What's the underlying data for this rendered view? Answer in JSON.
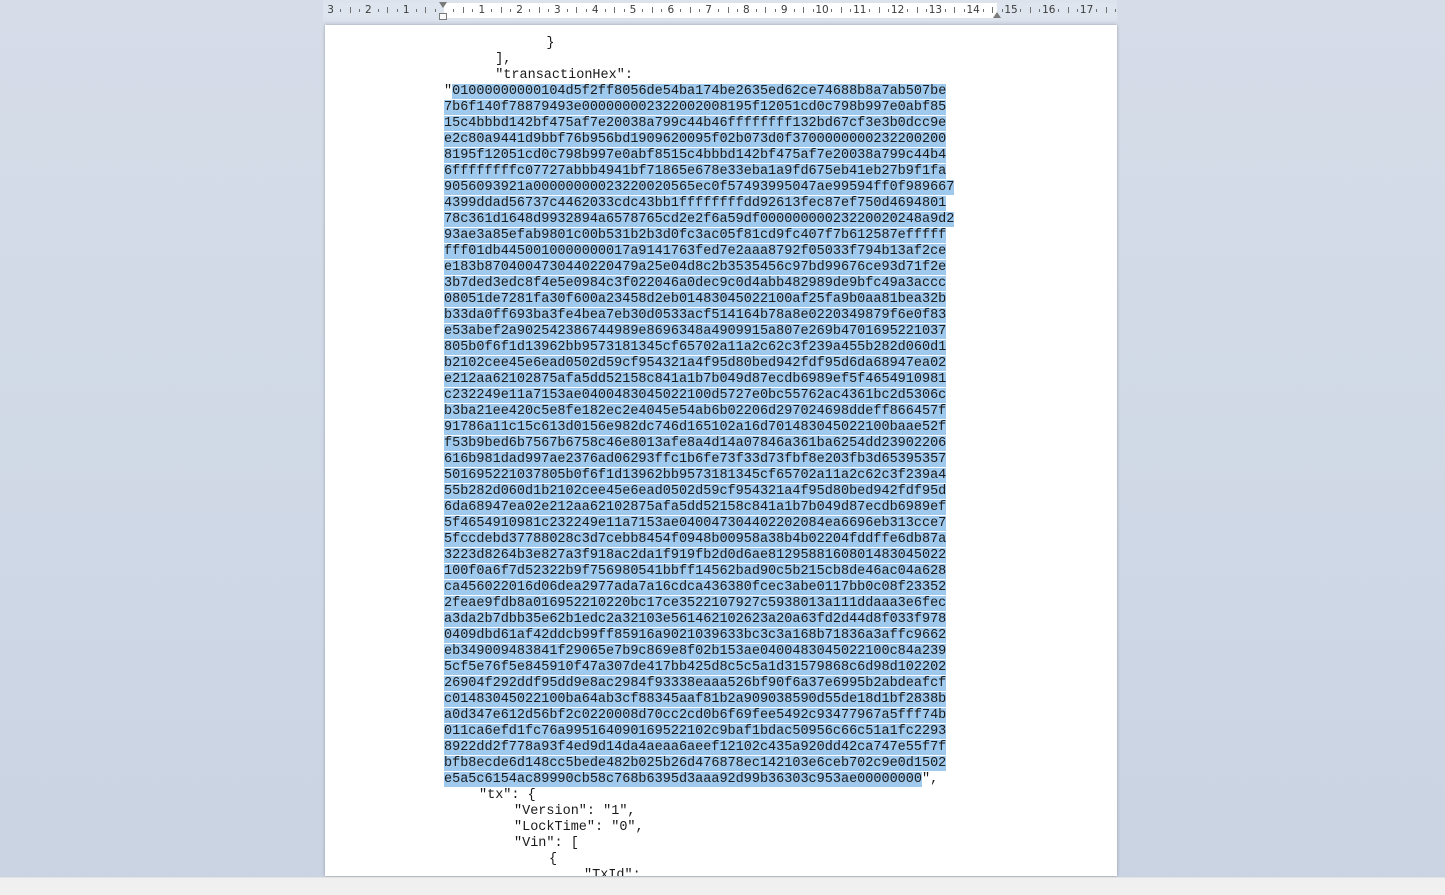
{
  "ruler": {
    "numbers": [
      "3",
      "2",
      "1",
      "1",
      "2",
      "3",
      "4",
      "5",
      "6",
      "7",
      "8",
      "9",
      "10",
      "11",
      "12",
      "13",
      "14",
      "15",
      "16",
      "17"
    ]
  },
  "document": {
    "lines_before": [
      "    }",
      "  ],",
      "  \"transactionHex\":"
    ],
    "hex_open_quote": "\"",
    "hex_lines": [
      "01000000000104d5f2ff8056de54ba174be2635ed62ce74688b8a7ab507be",
      "7b6f140f78879493e000000002322002008195f12051cd0c798b997e0abf85",
      "15c4bbbd142bf475af7e20038a799c44b46ffffffff132bd67cf3e3b0dcc9e",
      "e2c80a9441d9bbf76b956bd1909620095f02b073d0f3700000000232200200",
      "8195f12051cd0c798b997e0abf8515c4bbbd142bf475af7e20038a799c44b4",
      "6ffffffffc07727abbb4941bf71865e678e33eba1a9fd675eb41eb27b9f1fa",
      "9056093921a000000000232200205 65ec0f57493995047ae99594ff0f989667",
      "4399ddad56737c4462033cdc43bb1ffffffffdd92613fec87ef750d4694801",
      "78c361d1648d9932894a6578765cd2e2f6a59df000000000232200 20248a9d2",
      "93ae3a85efab9801c00b531b2b3d0fc3ac05f81cd9fc407f7b612587efffff",
      "fff01db4450010000000017a9141763fed7e2aaa8792f05033f794b13af2ce",
      "e183b8704004730440220479a25e04d8c2b3535456c97bd99676ce93d71f2e",
      "3b7ded3edc8f4e5e0984c3f022046a0dec9c0d4abb482989de9bfc49a3accc",
      "08051de7281fa30f600a23458d2eb01483045022100af25fa9b0aa81bea32b",
      "b33da0ff693ba3fe4bea7eb30d0533acf514164b78a8e0220349879f6e0f83",
      "e53abef2a902542386744989e8696348a4909915a807e269b4701695221037",
      "805b0f6f1d13962bb9573181345cf65702a11a2c62c3f239a455b282d060d1",
      "b2102cee45e6ead0502d59cf954321a4f95d80bed942fdf95d6da68947ea02",
      "e212aa62102875afa5dd52158c841a1b7b049d87ecdb6989ef5f4654910981",
      "c232249e11a7153ae0400483045022100d5727e0bc55762ac4361bc2d5306c",
      "b3ba21ee420c5e8fe182ec2e4045e54ab6b02206d297024698ddeff866457f",
      "91786a11c15c613d0156e982dc746d165102a16d701483045022100baae52f",
      "f53b9bed6b7567b6758c46e8013afe8a4d14a07846a361ba6254dd23902206",
      "616b981dad997ae2376ad06293ffc1b6fe73f33d73fbf8e203fb3d65395357",
      "501695221037805b0f6f1d13962bb9573181345cf65702a11a2c62c3f239a4",
      "55b282d060d1b2102cee45e6ead0502d59cf954321a4f95d80bed942fdf95d",
      "6da68947ea02e212aa62102875afa5dd52158c841a1b7b049d87ecdb6989ef",
      "5f4654910981c232249e11a7153ae040047304402202084ea6696eb313cce7",
      "5fccdebd37788028c3d7cebb8454f0948b00958a38b4b02204fddffe6db87a",
      "3223d8264b3e827a3f918ac2da1f919fb2d0d6ae8129588160801483045022",
      "100f0a6f7d52322b9f756980541bbff14562bad90c5b215cb8de46ac04a628",
      "ca456022016d06dea2977ada7a16cdca436380fcec3abe0117bb0c08f23352",
      "2feae9fdb8a016952210220bc17ce3522107927c5938013a111ddaaa3e6fec",
      "a3da2b7dbb35e62b1edc2a32103e561462102623a20a63fd2d44d8f033f978",
      "0409dbd61af42ddcb99ff85916a9021039633bc3c3a168b71836a3affc9662",
      "eb349009483841f29065e7b9c869e8f02b153ae0400483045022100c84a239",
      "5cf5e76f5e845910f47a307de417bb425d8c5c5a1d31579868c6d98d102202",
      "26904f292ddf95dd9e8ac2984f93338eaaa526bf90f6a37e6995b2abdeafcf",
      "c01483045022100ba64ab3cf88345aaf81b2a909038590d55de18d1bf2838b",
      "a0d347e612d56bf2c0220008d70cc2cd0b6f69fee5492c93477967a5fff74b",
      "011ca6efd1fc76a99516409016952210 2c9baf1bdac50956c66c51a1fc2293",
      "8922dd2f778a93f4ed9d14da4aeaa6aeef12102c435a920dd42ca747e55f7f",
      "bfb8ecde6d148cc5bede482b025b26d476878ec142103e6ceb702c9e0d1502",
      "e5a5c6154ac89990cb58c768b6395d3aaa92d99b36303c953ae00000000"
    ],
    "hex_close": "\",",
    "lines_after": [
      "  \"tx\": {",
      "    \"Version\": \"1\",",
      "    \"LockTime\": \"0\",",
      "    \"Vin\": [",
      "      {",
      "        \"TxId\":"
    ]
  }
}
